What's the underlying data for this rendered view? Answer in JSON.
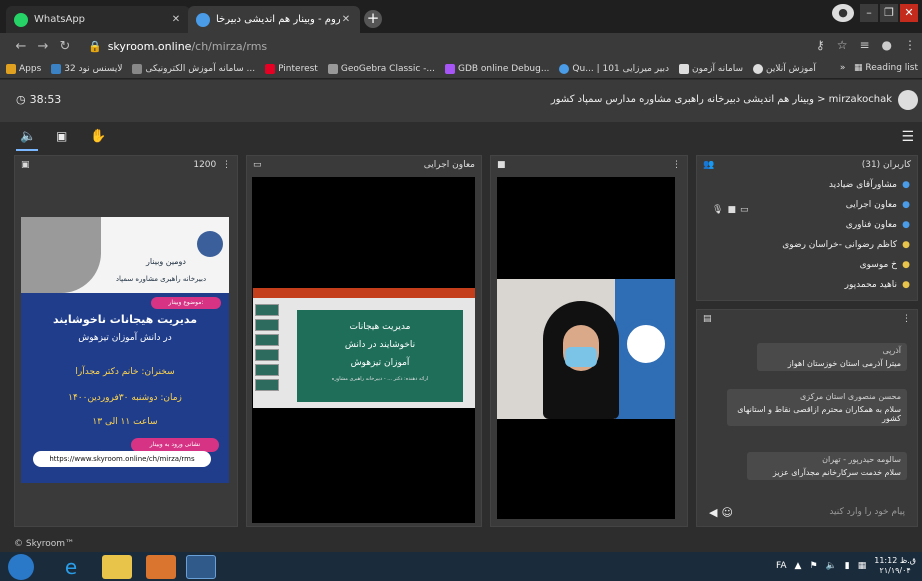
{
  "browser": {
    "tabs": [
      {
        "title": "WhatsApp",
        "active": false
      },
      {
        "title": "اسکای‌روم - وبینار هم اندیشی دبیرخا...",
        "active": true
      }
    ],
    "address": {
      "host": "skyroom.online",
      "path": "/ch/mirza/rms"
    },
    "bookmarks": [
      "Apps",
      "لایسنس نود 32",
      "سامانه آموزش الکترونیکی ...",
      "Pinterest",
      "GeoGebra Classic -...",
      "GDB online Debug...",
      "Qu... | 101 دبیر میرزایی",
      "سامانه آزمون",
      "آموزش آنلاین"
    ],
    "reading_list": "Reading list",
    "more": "»"
  },
  "header": {
    "timer": "38:53",
    "room_title": "mirzakochak < وبینار هم اندیشی دبیرخانه راهبری مشاوره مدارس سمپاد کشور"
  },
  "panels": {
    "presentation": {
      "count": "1200"
    },
    "screen_share": {
      "title": "معاون اجرایی"
    },
    "users": {
      "title": "کاربران (31)"
    }
  },
  "slide": {
    "line1": "دومین وبینار",
    "line2": "دبیرخانه راهبری مشاوره سمپاد",
    "badge1": "موضوع وبینار:",
    "heading1": "مدیریت هیجانات ناخوشایند",
    "heading2": "در دانش آموزان تیزهوش",
    "info1": "سخنران: خانم دکتر مجدآرا",
    "info2": "زمان: دوشنبه ۳۰فروردین۱۴۰۰",
    "info3": "ساعت ۱۱ الی ۱۳",
    "badge2": "نشانی ورود به وبینار",
    "url": "https://www.skyroom.online/ch/mirza/rms"
  },
  "screen_slide": {
    "l1": "مدیریت هیجانات",
    "l2": "ناخوشایند در دانش",
    "l3": "آموزان تیزهوش",
    "l4": "ارائه دهنده: دکتر ... - دبیرخانه راهبری مشاوره"
  },
  "users": [
    {
      "name": "مشاورآقای ضیادید",
      "color": "blue"
    },
    {
      "name": "معاون اجرایی",
      "color": "blue"
    },
    {
      "name": "معاون فناوری",
      "color": "blue"
    },
    {
      "name": "کاظم رضوانی -خراسان رضوی",
      "color": "gold"
    },
    {
      "name": "خ موسوی",
      "color": "gold"
    },
    {
      "name": "ناهید محمدپور",
      "color": "gold"
    }
  ],
  "chat": {
    "messages": [
      {
        "name": "آذرپی",
        "text": "میترا آذرمی استان خوزستان اهواز"
      },
      {
        "name": "محسن منصوری استان مرکزی",
        "text": "سلام به همکاران محترم ازاقصی نقاط و استانهای کشور"
      },
      {
        "name": "سالومه حیدرپور - تهران",
        "text": "سلام خدمت سرکارخانم مجدآرای عزیز"
      }
    ],
    "placeholder": "پیام خود را وارد کنید"
  },
  "footer": "© Skyroom™",
  "taskbar": {
    "lang": "FA",
    "time": "11:12 ق.ظ",
    "date": "۲۱/۱۹/۰۴"
  },
  "colors": {
    "accent": "#7ab7ff",
    "user_blue": "#4a9be8",
    "user_gold": "#e8c44a",
    "badge": "#d63384"
  }
}
